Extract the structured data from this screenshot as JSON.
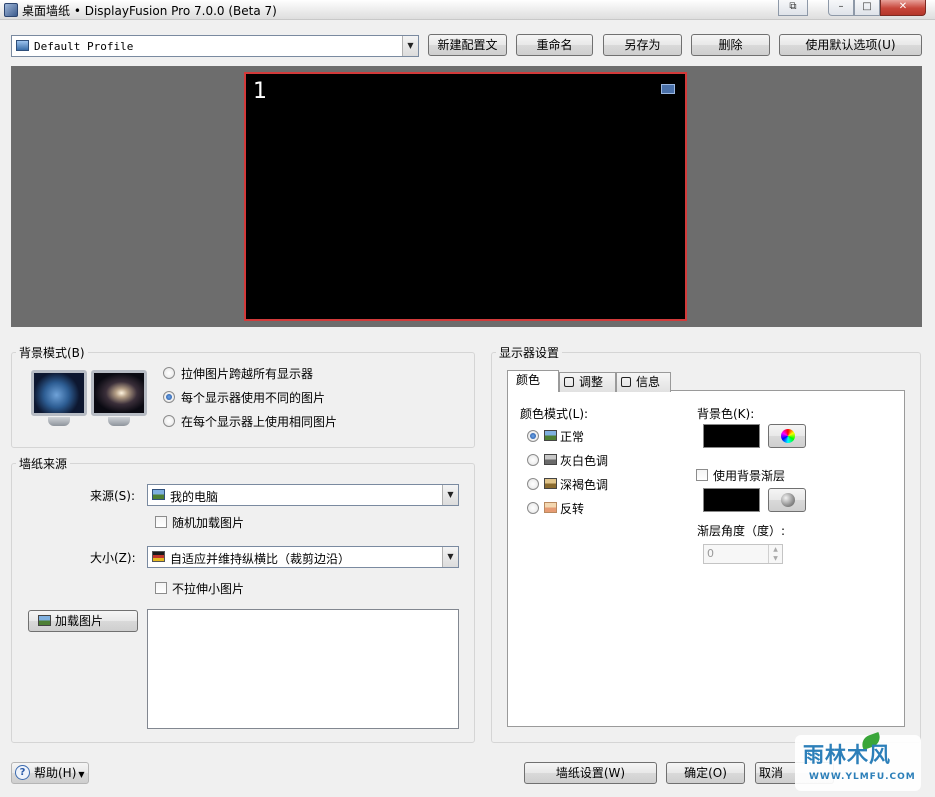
{
  "window": {
    "title": "桌面墙纸 • DisplayFusion Pro 7.0.0 (Beta 7)",
    "controls": {
      "minimize": "–",
      "maximize": "□",
      "close": "✕",
      "extra": "⧉"
    }
  },
  "toolbar": {
    "profile_value": "Default Profile",
    "buttons": {
      "new_profile": "新建配置文",
      "rename": "重命名",
      "save_as": "另存为",
      "delete": "删除",
      "use_defaults": "使用默认选项(U)"
    }
  },
  "preview": {
    "monitor_number": "1"
  },
  "background_mode": {
    "title": "背景模式(B)",
    "options": [
      {
        "label": "拉伸图片跨越所有显示器",
        "selected": false
      },
      {
        "label": "每个显示器使用不同的图片",
        "selected": true
      },
      {
        "label": "在每个显示器上使用相同图片",
        "selected": false
      }
    ]
  },
  "wallpaper_source": {
    "title": "墙纸来源",
    "source_label": "来源(S):",
    "source_value": "我的电脑",
    "random_label": "随机加载图片",
    "random_checked": false,
    "size_label": "大小(Z):",
    "size_value": "自适应并维持纵横比（裁剪边沿）",
    "no_stretch_label": "不拉伸小图片",
    "no_stretch_checked": false,
    "load_button": "加载图片"
  },
  "monitor_settings": {
    "title": "显示器设置",
    "tabs": [
      {
        "label": "颜色",
        "active": true
      },
      {
        "label": "调整",
        "active": false
      },
      {
        "label": "信息",
        "active": false
      }
    ],
    "color_mode_label": "颜色模式(L):",
    "color_modes": [
      {
        "label": "正常",
        "selected": true,
        "icon": "picture-normal-icon"
      },
      {
        "label": "灰白色调",
        "selected": false,
        "icon": "picture-grayscale-icon"
      },
      {
        "label": "深褐色调",
        "selected": false,
        "icon": "picture-sepia-icon"
      },
      {
        "label": "反转",
        "selected": false,
        "icon": "picture-invert-icon"
      }
    ],
    "bg_color_label": "背景色(K):",
    "bg_color": "#000000",
    "gradient_label": "使用背景渐层",
    "gradient_checked": false,
    "gradient_color": "#000000",
    "gradient_angle_label": "渐层角度（度）:",
    "gradient_angle_value": "0"
  },
  "footer": {
    "help_button": "帮助(H)",
    "wallpaper_settings_button": "墙纸设置(W)",
    "ok_button": "确定(O)",
    "cancel_button": "取消"
  },
  "watermark": {
    "main": "雨林木风",
    "sub": "WWW.YLMFU.COM"
  }
}
